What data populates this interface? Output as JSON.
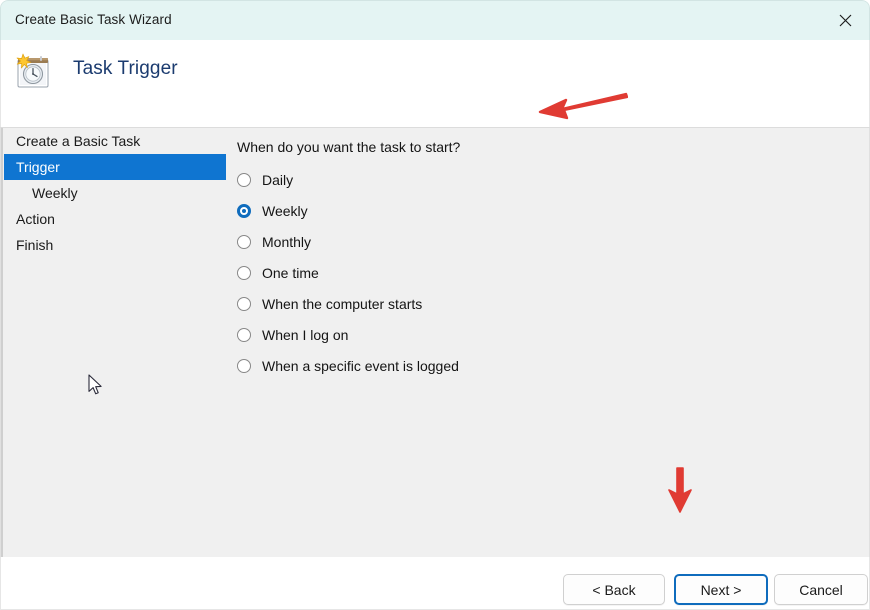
{
  "window": {
    "title": "Create Basic Task Wizard",
    "close_icon": "close-icon"
  },
  "header": {
    "icon": "task-scheduler-calendar-clock-icon",
    "title": "Task Trigger"
  },
  "sidebar": {
    "items": [
      {
        "label": "Create a Basic Task",
        "selected": false,
        "indent": false
      },
      {
        "label": "Trigger",
        "selected": true,
        "indent": false
      },
      {
        "label": "Weekly",
        "selected": false,
        "indent": true
      },
      {
        "label": "Action",
        "selected": false,
        "indent": false
      },
      {
        "label": "Finish",
        "selected": false,
        "indent": false
      }
    ]
  },
  "main": {
    "question": "When do you want the task to start?",
    "options": [
      {
        "label": "Daily",
        "checked": false
      },
      {
        "label": "Weekly",
        "checked": true
      },
      {
        "label": "Monthly",
        "checked": false
      },
      {
        "label": "One time",
        "checked": false
      },
      {
        "label": "When the computer starts",
        "checked": false
      },
      {
        "label": "When I log on",
        "checked": false
      },
      {
        "label": "When a specific event is logged",
        "checked": false
      }
    ]
  },
  "footer": {
    "back_label": "< Back",
    "next_label": "Next >",
    "cancel_label": "Cancel"
  },
  "annotations": {
    "arrow_color": "#e03b33",
    "arrow_left": "arrow-pointing-left",
    "arrow_down": "arrow-pointing-down"
  },
  "colors": {
    "titlebar_bg": "#e4f4f3",
    "panel_bg": "#f0f0f0",
    "selection_blue": "#0f75d1",
    "accent_blue": "#0f6cbd",
    "header_title": "#1b3b6f"
  }
}
